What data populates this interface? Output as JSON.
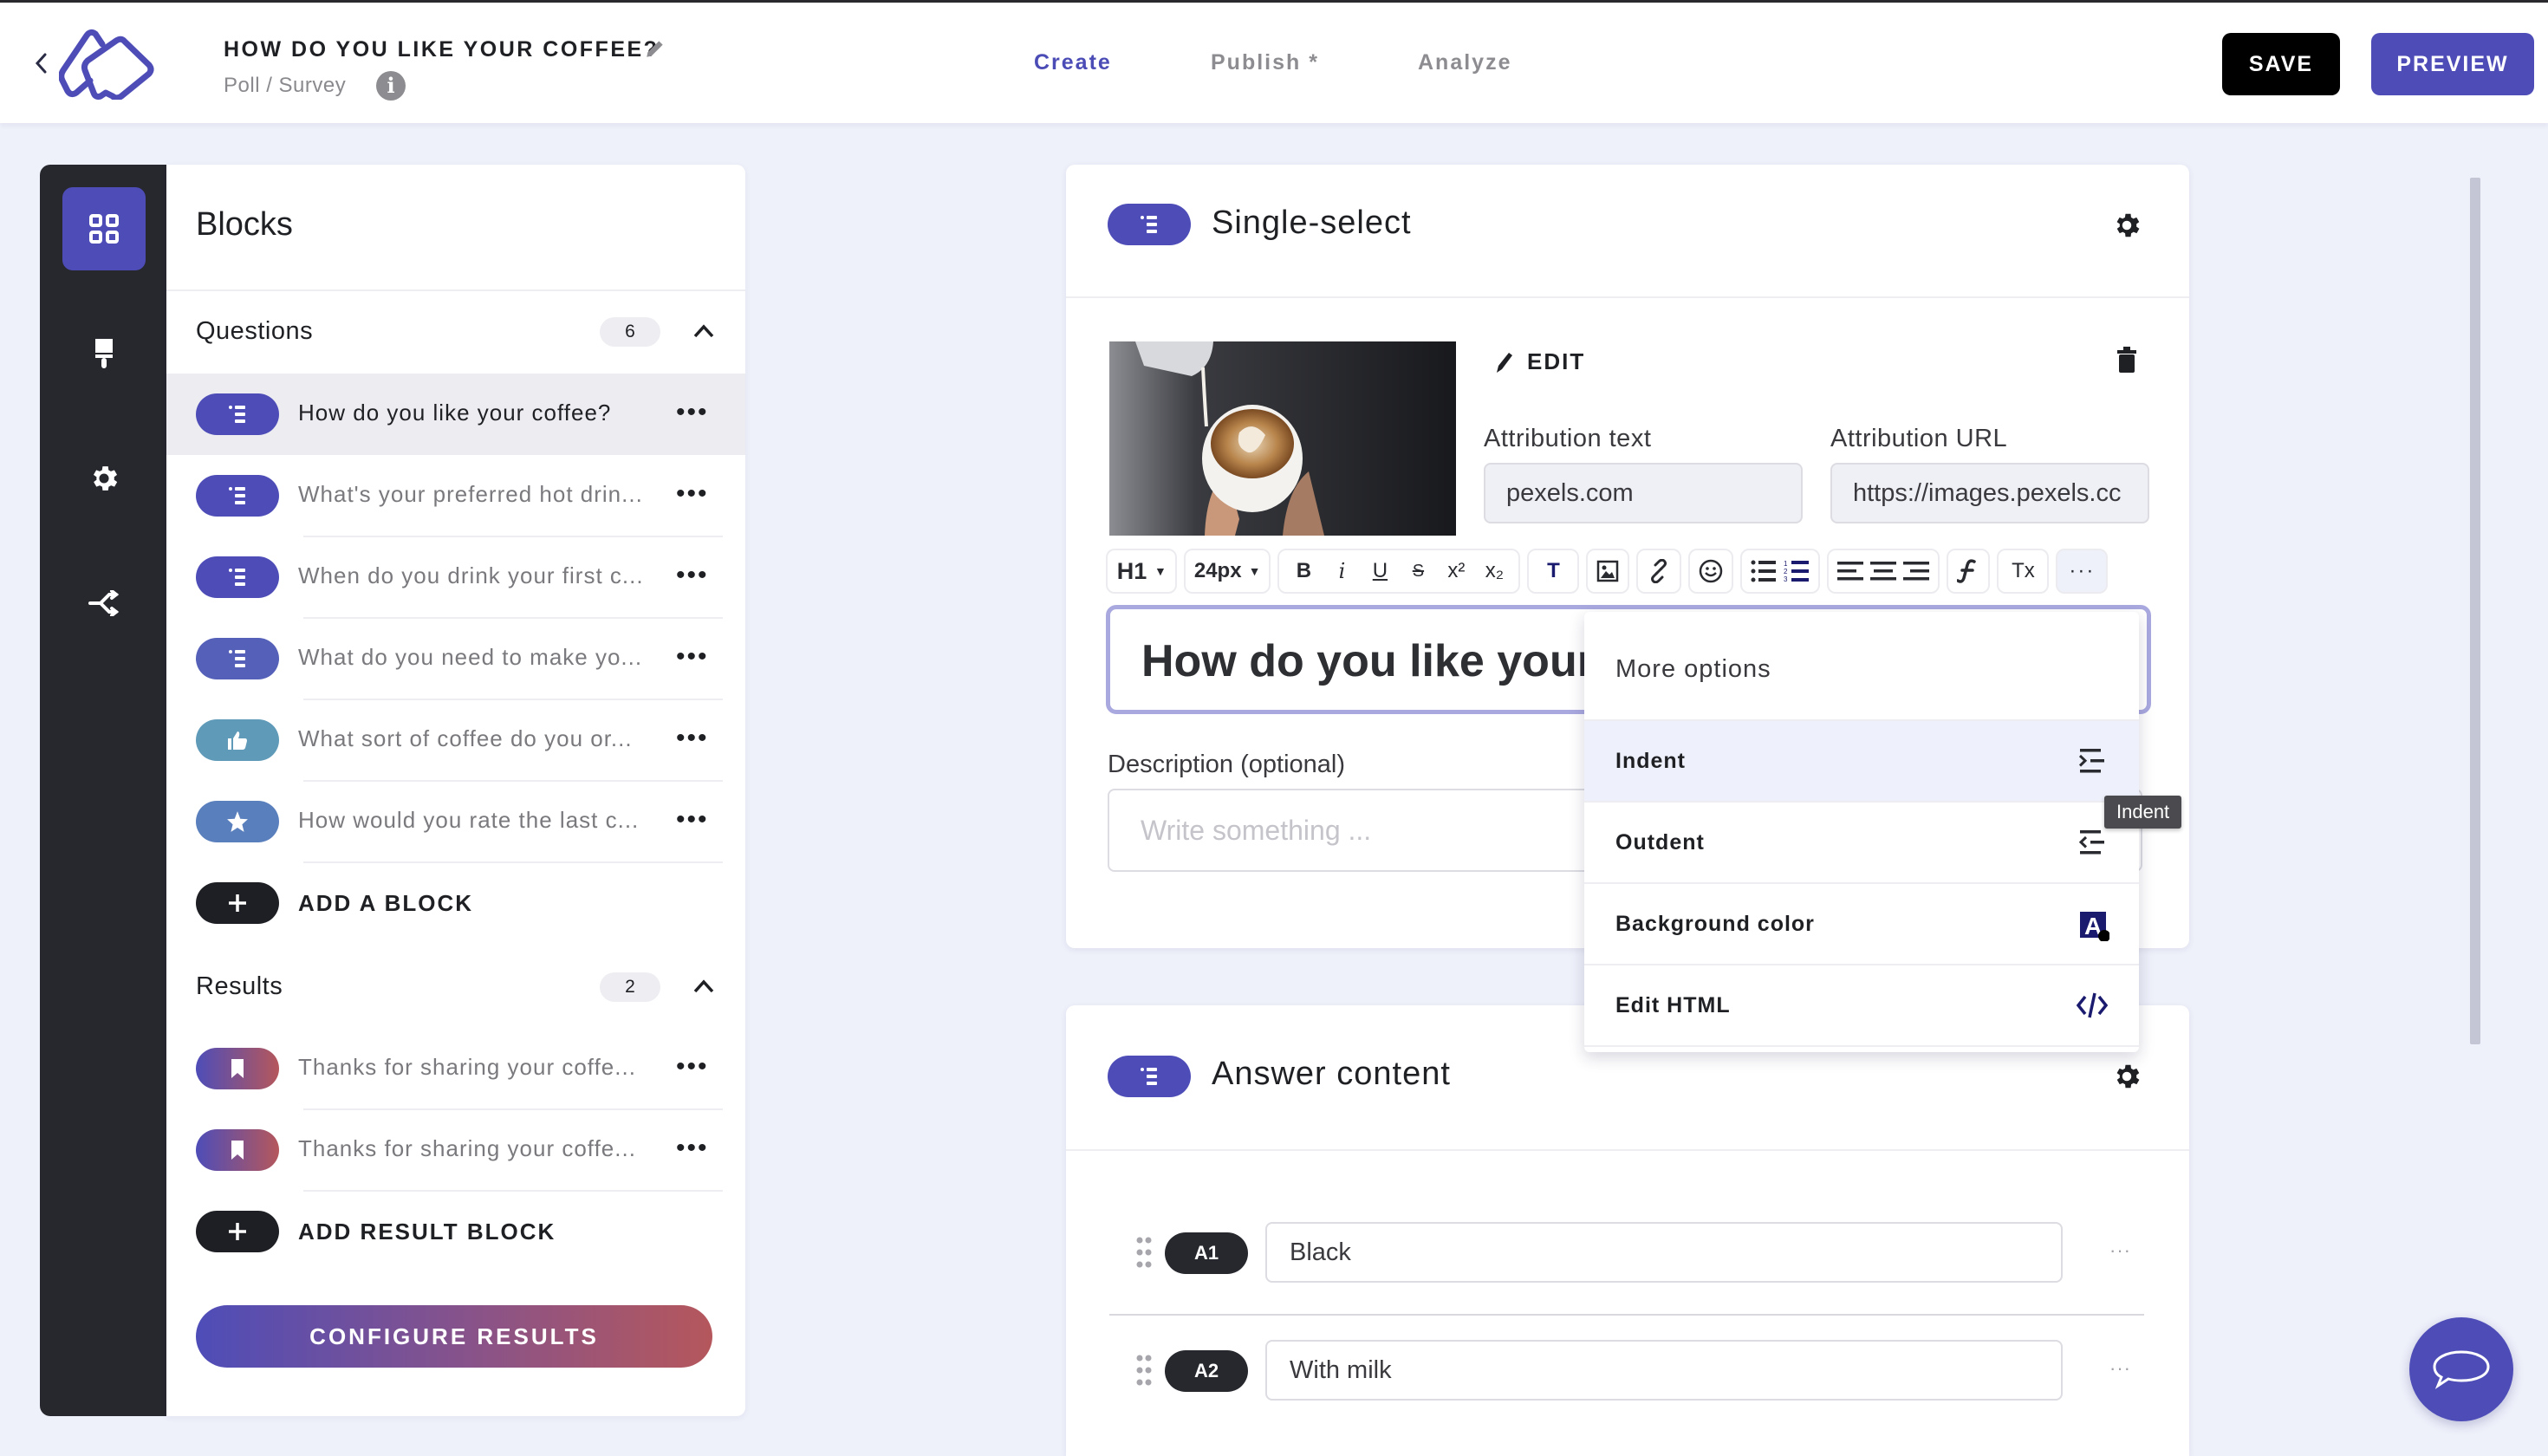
{
  "header": {
    "back_icon": "chevron-left-icon",
    "logo": "app-logo",
    "title": "HOW DO YOU LIKE YOUR COFFEE?",
    "subtitle": "Poll / Survey",
    "info_glyph": "i",
    "tabs": [
      {
        "label": "Create",
        "active": true
      },
      {
        "label": "Publish *",
        "active": false
      },
      {
        "label": "Analyze",
        "active": false
      }
    ],
    "save_label": "SAVE",
    "preview_label": "PREVIEW"
  },
  "rail": {
    "items": [
      {
        "icon": "blocks-grid-icon",
        "active": true
      },
      {
        "icon": "paintbrush-icon",
        "active": false
      },
      {
        "icon": "gear-icon",
        "active": false
      },
      {
        "icon": "branch-logic-icon",
        "active": false
      }
    ]
  },
  "blocks_panel": {
    "title": "Blocks",
    "questions": {
      "label": "Questions",
      "count": "6",
      "items": [
        {
          "text": "How do you like your coffee?",
          "icon": "list-icon",
          "selected": true
        },
        {
          "text": "What's your preferred hot drin...",
          "icon": "list-icon",
          "selected": false
        },
        {
          "text": "When do you drink your first c...",
          "icon": "list-icon",
          "selected": false
        },
        {
          "text": "What do you need to make yo...",
          "icon": "list-icon",
          "selected": false
        },
        {
          "text": "What sort of coffee do you or...",
          "icon": "thumbs-up-icon",
          "selected": false
        },
        {
          "text": "How would you rate the last c...",
          "icon": "star-icon",
          "selected": false
        }
      ],
      "add_label": "ADD A BLOCK"
    },
    "results": {
      "label": "Results",
      "count": "2",
      "items": [
        {
          "text": "Thanks for sharing your coffe...",
          "icon": "bookmark-icon"
        },
        {
          "text": "Thanks for sharing your coffe...",
          "icon": "bookmark-icon"
        }
      ],
      "add_label": "ADD RESULT BLOCK"
    },
    "more_glyph": "•••",
    "configure_label": "CONFIGURE RESULTS"
  },
  "question_card": {
    "type_label": "Single-select",
    "image_alt": "latte art coffee cup",
    "edit_label": "EDIT",
    "attribution_text_label": "Attribution text",
    "attribution_text_value": "pexels.com",
    "attribution_url_label": "Attribution URL",
    "attribution_url_value": "https://images.pexels.cc",
    "toolbar": {
      "heading": "H1",
      "font_size": "24px",
      "bold": "B",
      "italic": "i",
      "underline": "U",
      "strike": "S",
      "superscript": "x²",
      "subscript": "x₂",
      "text_color": "T",
      "clear_format": "Tx",
      "more": "···"
    },
    "headline": "How do you like your coffee?",
    "description_label": "Description (optional)",
    "description_placeholder": "Write something ..."
  },
  "more_options_menu": {
    "title": "More options",
    "items": [
      {
        "label": "Indent",
        "icon": "indent-icon",
        "hovered": true
      },
      {
        "label": "Outdent",
        "icon": "outdent-icon",
        "hovered": false
      },
      {
        "label": "Background color",
        "icon": "background-color-icon",
        "hovered": false
      },
      {
        "label": "Edit HTML",
        "icon": "code-icon",
        "hovered": false
      }
    ],
    "tooltip": "Indent"
  },
  "answer_card": {
    "title": "Answer content",
    "answers": [
      {
        "badge": "A1",
        "value": "Black"
      },
      {
        "badge": "A2",
        "value": "With milk"
      }
    ],
    "more_glyph": "···"
  },
  "colors": {
    "accent": "#4e4db8",
    "rail_bg": "#27282e",
    "page_bg": "#eef0fa",
    "gradient_start": "#4e4db8",
    "gradient_end": "#b5575c",
    "thumbs_pill": "#5f9ab8",
    "star_pill": "#5a7fbd"
  }
}
